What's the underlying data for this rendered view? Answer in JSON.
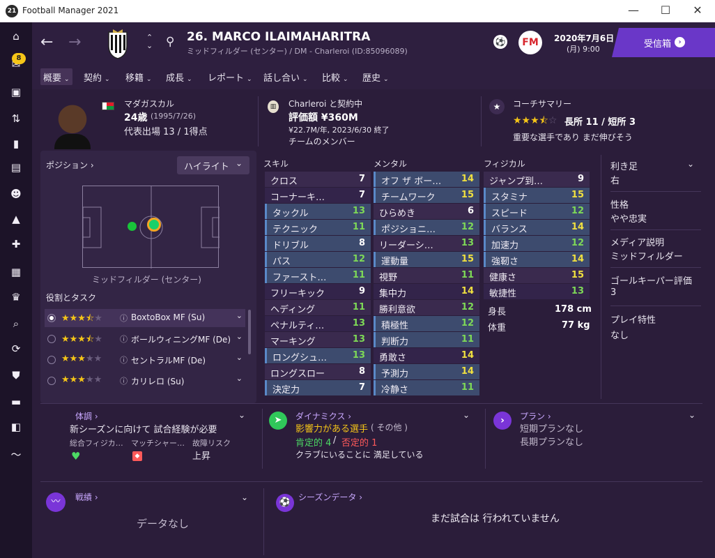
{
  "window": {
    "title": "Football Manager 2021",
    "logo": "21",
    "minimize": "—",
    "maximize": "☐",
    "close": "✕"
  },
  "sidebar": {
    "inbox_badge": "8"
  },
  "header": {
    "player_title": "26. MARCO ILAIMAHARITRA",
    "player_subtitle": "ミッドフィルダー (センター) / DM - Charleroi (ID:85096089)",
    "date": "2020年7月6日",
    "time": "(月) 9:00",
    "inbox_label": "受信箱"
  },
  "tabs": [
    {
      "label": "概要"
    },
    {
      "label": "契約"
    },
    {
      "label": "移籍"
    },
    {
      "label": "成長"
    },
    {
      "label": "レポート"
    },
    {
      "label": "話し合い"
    },
    {
      "label": "比較"
    },
    {
      "label": "歴史"
    }
  ],
  "profile": {
    "nationality": "マダガスカル",
    "age": "24歳",
    "birth": "(1995/7/26)",
    "caps": "代表出場 13 / 1得点",
    "club_status": "Charleroi と契約中",
    "value": "評価額 ¥360M",
    "wage": "¥22.7M/年, 2023/6/30 終了",
    "squad_status": "チームのメンバー",
    "coach_summary_label": "コーチサマリー",
    "strengths": "長所 11 / 短所 3",
    "coach_comment": "重要な選手であり まだ伸びそう",
    "star_rating": 3.5
  },
  "position_panel": {
    "label": "ポジション",
    "highlight_dropdown": "ハイライト",
    "position_name": "ミッドフィルダー (センター)",
    "roles_label": "役割とタスク",
    "roles": [
      {
        "name": "BoxtoBox MF (Su)",
        "stars": 3.5,
        "selected": true
      },
      {
        "name": "ボールウィニングMF (De)",
        "stars": 3.5,
        "selected": false
      },
      {
        "name": "セントラルMF (De)",
        "stars": 3,
        "selected": false
      },
      {
        "name": "カリレロ (Su)",
        "stars": 3,
        "selected": false
      }
    ]
  },
  "attributes": {
    "skill_header": "スキル",
    "mental_header": "メンタル",
    "physical_header": "フィジカル",
    "skill": [
      {
        "name": "クロス",
        "value": 7
      },
      {
        "name": "コーナーキ…",
        "value": 7
      },
      {
        "name": "タックル",
        "value": 13,
        "highlight": true
      },
      {
        "name": "テクニック",
        "value": 11,
        "highlight": true
      },
      {
        "name": "ドリブル",
        "value": 8,
        "highlight": true
      },
      {
        "name": "パス",
        "value": 12,
        "highlight": true
      },
      {
        "name": "ファースト…",
        "value": 11,
        "highlight": true
      },
      {
        "name": "フリーキック",
        "value": 9
      },
      {
        "name": "ヘディング",
        "value": 11
      },
      {
        "name": "ペナルティ…",
        "value": 13
      },
      {
        "name": "マーキング",
        "value": 13
      },
      {
        "name": "ロングシュ…",
        "value": 13,
        "highlight": true
      },
      {
        "name": "ロングスロー",
        "value": 8
      },
      {
        "name": "決定力",
        "value": 7,
        "highlight": true
      }
    ],
    "mental": [
      {
        "name": "オフ ザ ボー…",
        "value": 14,
        "highlight": true
      },
      {
        "name": "チームワーク",
        "value": 15,
        "highlight": true
      },
      {
        "name": "ひらめき",
        "value": 6
      },
      {
        "name": "ポジショニ…",
        "value": 12,
        "highlight": true
      },
      {
        "name": "リーダーシ…",
        "value": 13
      },
      {
        "name": "運動量",
        "value": 15,
        "highlight": true
      },
      {
        "name": "視野",
        "value": 11
      },
      {
        "name": "集中力",
        "value": 14
      },
      {
        "name": "勝利意欲",
        "value": 12
      },
      {
        "name": "積極性",
        "value": 12,
        "highlight": true
      },
      {
        "name": "判断力",
        "value": 11,
        "highlight": true
      },
      {
        "name": "勇敢さ",
        "value": 14
      },
      {
        "name": "予測力",
        "value": 14,
        "highlight": true
      },
      {
        "name": "冷静さ",
        "value": 11,
        "highlight": true
      }
    ],
    "physical": [
      {
        "name": "ジャンプ到…",
        "value": 9
      },
      {
        "name": "スタミナ",
        "value": 15,
        "highlight": true
      },
      {
        "name": "スピード",
        "value": 12,
        "highlight": true
      },
      {
        "name": "バランス",
        "value": 14,
        "highlight": true
      },
      {
        "name": "加速力",
        "value": 12,
        "highlight": true
      },
      {
        "name": "強靭さ",
        "value": 14,
        "highlight": true
      },
      {
        "name": "健康さ",
        "value": 15
      },
      {
        "name": "敏捷性",
        "value": 13
      }
    ],
    "height_label": "身長",
    "height": "178 cm",
    "weight_label": "体重",
    "weight": "77 kg"
  },
  "side_info": {
    "foot_label": "利き足",
    "foot": "右",
    "personality_label": "性格",
    "personality": "やや忠実",
    "media_label": "メディア説明",
    "media": "ミッドフィルダー",
    "gk_label": "ゴールキーパー評価",
    "gk": "3",
    "traits_label": "プレイ特性",
    "traits": "なし"
  },
  "bottom": {
    "condition_label": "体調",
    "condition_text": "新シーズンに向けて 試合経験が必要",
    "fitness_label": "総合フィジカ…",
    "match_label": "マッチシャー…",
    "injury_label": "故障リスク",
    "injury_value": "上昇",
    "dynamics_label": "ダイナミクス",
    "influence": "影響力がある選手",
    "influence_sub": "( その他 )",
    "positive": "肯定的 4",
    "slash": "/",
    "negative": "否定的 1",
    "satisfaction": "クラブにいることに 満足している",
    "plans_label": "プラン",
    "plan_short": "短期プランなし",
    "plan_long": "長期プランなし",
    "form_label": "戦績",
    "form_empty": "データなし",
    "season_label": "シーズンデータ",
    "season_empty": "まだ試合は 行われていません"
  },
  "colors": {
    "accent": "#6a37c8",
    "star": "#f5c518",
    "value_high": "#f0e040",
    "value_mid": "#7ed957",
    "positive": "#4cd964",
    "negative": "#ff5a5a"
  }
}
